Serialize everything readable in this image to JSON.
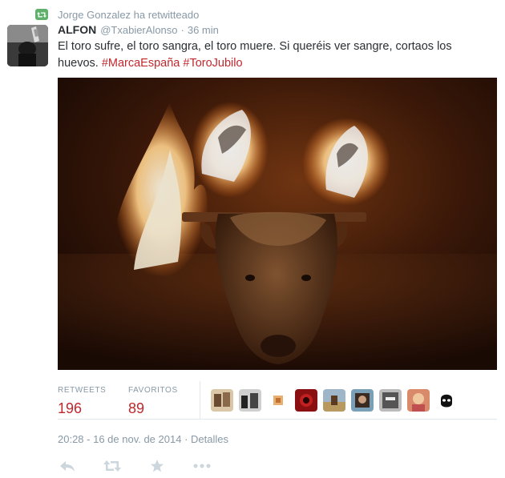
{
  "retweet_context": {
    "text": "Jorge Gonzalez ha retwitteado",
    "icon": "retweet-icon"
  },
  "tweet": {
    "author_name": "ALFON",
    "author_handle": "@TxabierAlonso",
    "separator": "·",
    "time_ago": "36 min",
    "text_plain": "El toro sufre, el toro sangra, el toro muere. Si queréis ver sangre, cortaos los huevos.",
    "hashtags": [
      "#MarcaEspaña",
      "#ToroJubilo"
    ]
  },
  "stats": {
    "retweets_label": "RETWEETS",
    "retweets_count": "196",
    "favorites_label": "FAVORITOS",
    "favorites_count": "89"
  },
  "meta": {
    "timestamp": "20:28 - 16 de nov. de 2014",
    "separator": "·",
    "details_link": "Detalles"
  },
  "actions": [
    "reply-icon",
    "retweet-icon",
    "favorite-icon",
    "more-icon"
  ],
  "colors": {
    "hashtag": "#c1272d",
    "muted": "#8899a6",
    "retweet_badge": "#5eb06a",
    "counts": "#c1272d"
  }
}
